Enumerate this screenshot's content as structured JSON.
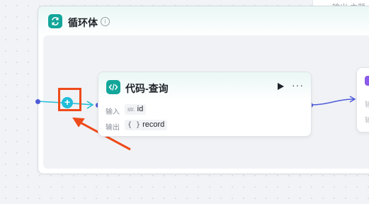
{
  "top_node": {
    "text": "输出  主题"
  },
  "loop_node": {
    "title": "循环体",
    "icon": "loop-icon",
    "accent": "#13a69a"
  },
  "code_node": {
    "title": "代码-查询",
    "icon": "code-icon",
    "input_label": "输入",
    "input_type": "str.",
    "input_value": "id",
    "output_label": "输出",
    "output_type": "{ }",
    "output_value": "record"
  },
  "right_node": {
    "line1": "输",
    "line2": "输"
  },
  "colors": {
    "connection": "#4e5bd8",
    "highlight": "#ee4a1a",
    "add_button": "#1fbdd8"
  }
}
